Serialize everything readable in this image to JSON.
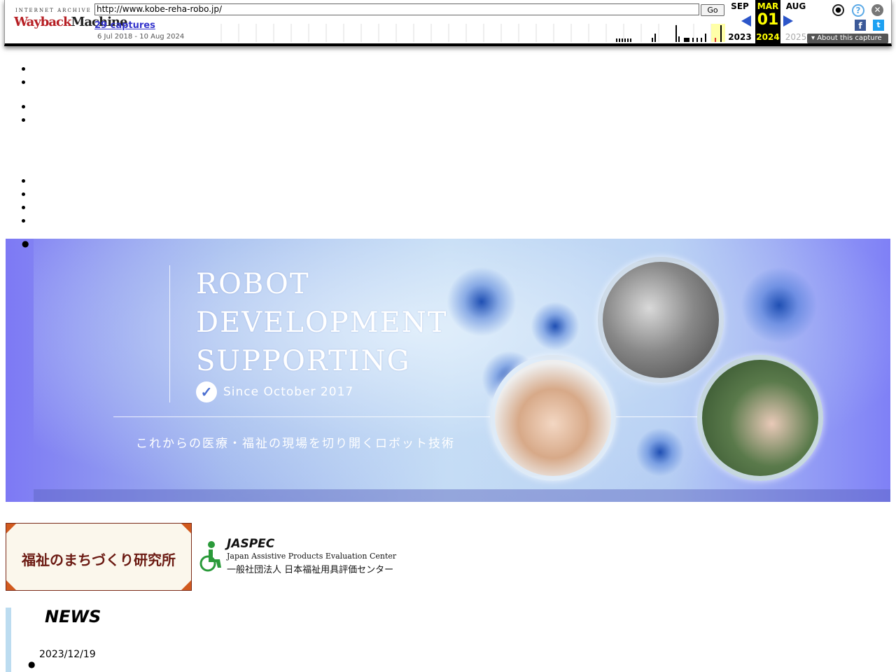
{
  "wayback": {
    "logo_top": "INTERNET ARCHIVE",
    "logo_main_1": "Wayback",
    "logo_main_2": "Machine",
    "url": "http://www.kobe-reha-robo.jp/",
    "go_label": "Go",
    "captures": "29 captures",
    "date_range": "6 Jul 2018 - 10 Aug 2024",
    "prev_month": "SEP",
    "cur_month": "MAR",
    "next_month": "AUG",
    "prev_year": "2023",
    "cur_day": "01",
    "cur_year": "2024",
    "next_year": "2025",
    "about": "▾ About this capture",
    "fb": "f",
    "tw": "t"
  },
  "nav1": [
    "",
    ""
  ],
  "nav2": [
    " ",
    ""
  ],
  "site_title": "",
  "menu": [
    "",
    "",
    "",
    ""
  ],
  "hero": {
    "line1": "ROBOT",
    "line2": "DEVELOPMENT",
    "line3": "SUPPORTING",
    "since": "Since October 2017",
    "tagline": "これからの医療・福祉の現場を切り開くロボット技術"
  },
  "banners": {
    "b1_text": "福祉のまちづくり研究所",
    "b2_line1": "JASPEC",
    "b2_line2": "Japan Assistive Products Evaluation Center",
    "b2_line3": "一般社団法人 日本福祉用具評価センター"
  },
  "news": {
    "heading": "NEWS",
    "date": "2023/12/19",
    "link": ""
  }
}
